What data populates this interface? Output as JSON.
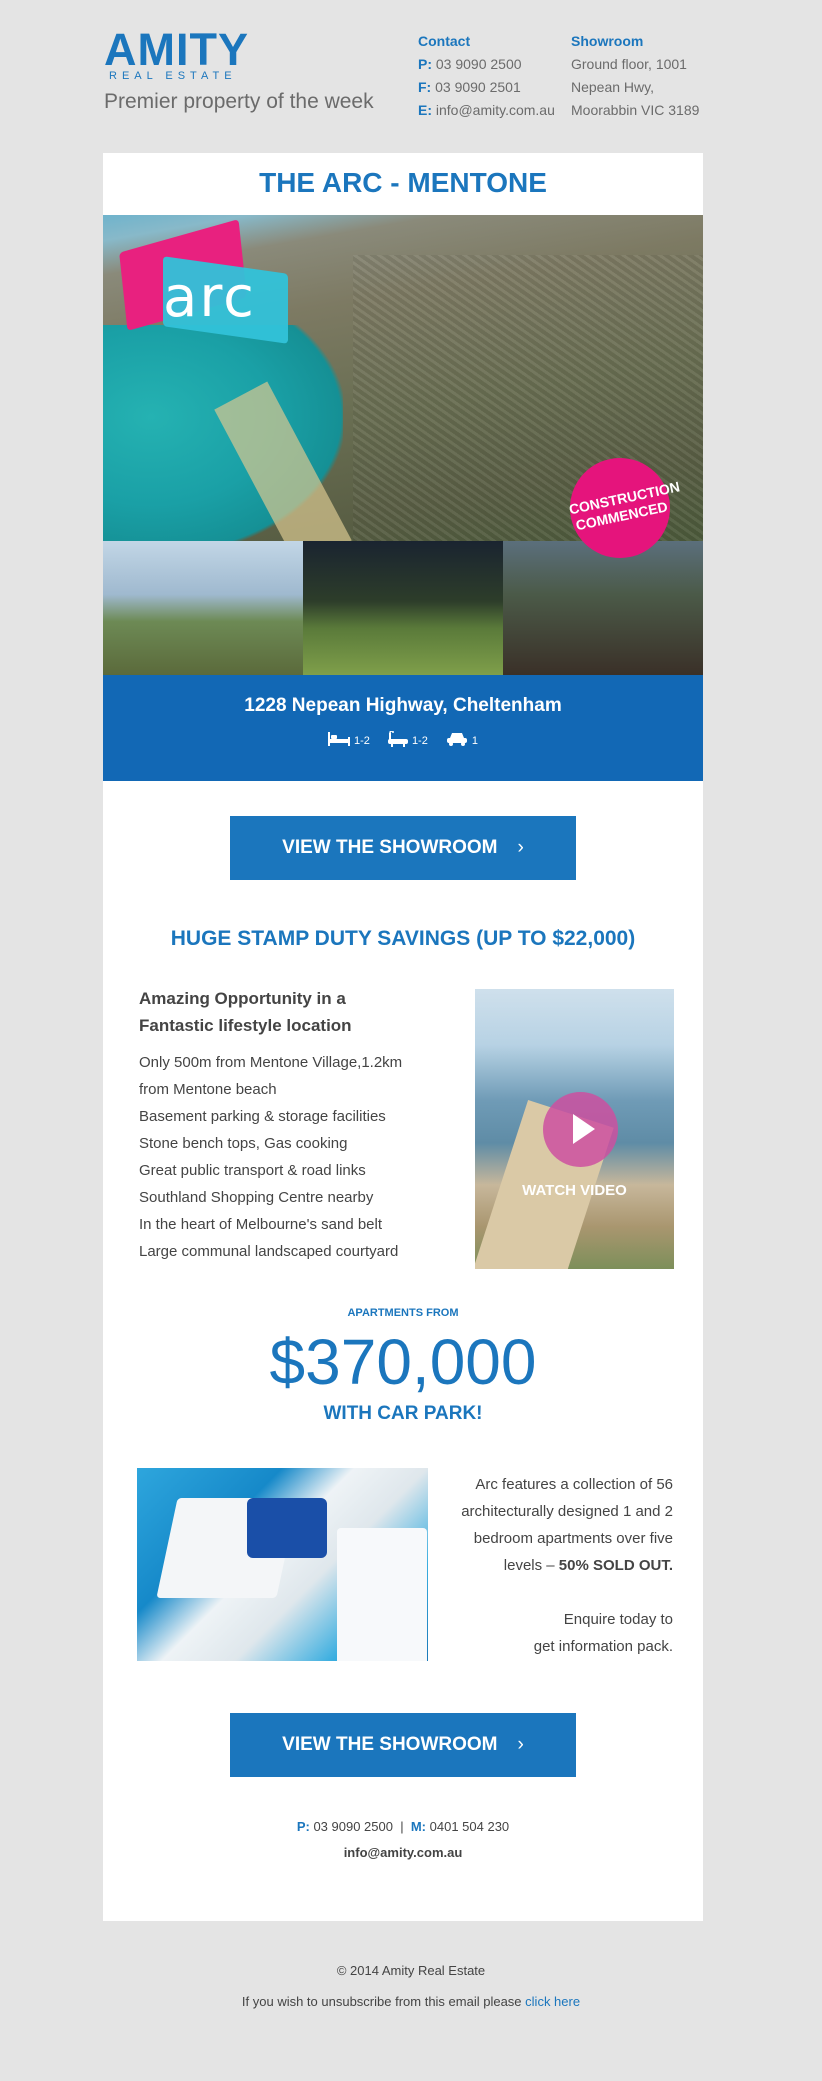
{
  "header": {
    "logo_main": "AMITY",
    "logo_sub": "REAL ESTATE",
    "tagline": "Premier property of the week",
    "contact": {
      "heading": "Contact",
      "phone_label": "P:",
      "phone": "03 9090 2500",
      "fax_label": "F:",
      "fax": "03 9090 2501",
      "email_label": "E:",
      "email": "info@amity.com.au"
    },
    "showroom": {
      "heading": "Showroom",
      "line1": "Ground floor, 1001",
      "line2": "Nepean Hwy,",
      "line3": "Moorabbin VIC 3189"
    }
  },
  "listing": {
    "title": "THE ARC - MENTONE",
    "logo_text": "arc",
    "badge_line1": "CONSTRUCTION",
    "badge_line2": "COMMENCED",
    "address": "1228 Nepean Highway, Cheltenham",
    "beds": "1-2",
    "baths": "1-2",
    "cars": "1",
    "icons": [
      "bed-icon",
      "bath-icon",
      "car-icon"
    ]
  },
  "cta": {
    "label": "VIEW THE SHOWROOM",
    "chevron": "›"
  },
  "stamp_duty": "HUGE STAMP DUTY SAVINGS (UP TO $22,000)",
  "opportunity": {
    "title_line1": "Amazing Opportunity in a",
    "title_line2": "Fantastic lifestyle location",
    "items": [
      "Only 500m from Mentone Village,1.2km",
      "from Mentone beach",
      "Basement parking & storage facilities",
      "Stone bench tops, Gas cooking",
      "Great public transport & road links",
      "Southland Shopping Centre nearby",
      "In the heart of Melbourne's sand belt",
      "Large communal landscaped courtyard"
    ]
  },
  "video": {
    "label": "WATCH VIDEO"
  },
  "pricing": {
    "from_label": "APARTMENTS FROM",
    "price": "$370,000",
    "extra": "WITH CAR PARK!"
  },
  "features": {
    "line1": "Arc features a collection of 56",
    "line2": "architecturally designed 1 and 2",
    "line3": "bedroom apartments over five",
    "line4_prefix": "levels – ",
    "line4_bold": "50% SOLD OUT.",
    "enquire1": "Enquire today to",
    "enquire2": "get information pack."
  },
  "footer": {
    "p_label": "P:",
    "phone": "03 9090 2500",
    "separator": "|",
    "m_label": "M:",
    "mobile": "0401 504 230",
    "email": "info@amity.com.au",
    "copyright": "© 2014 Amity Real Estate",
    "unsub_text": "If you wish to unsubscribe from this email please",
    "unsub_link": "click here"
  },
  "colors": {
    "brand_blue": "#1b76bd",
    "band_blue": "#1268b5",
    "badge_pink": "#e5147c",
    "page_bg": "#e4e4e4"
  }
}
